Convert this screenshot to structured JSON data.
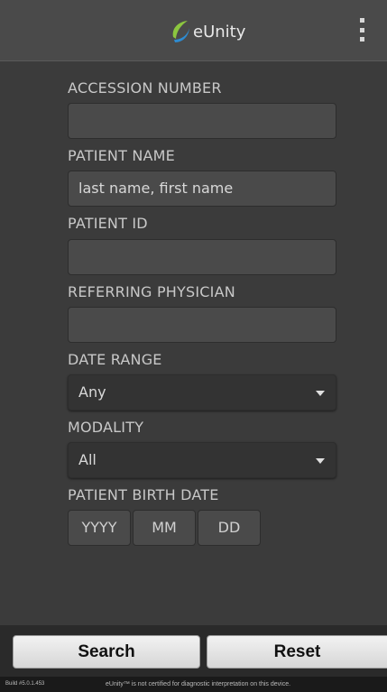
{
  "header": {
    "app_name": "eUnity",
    "logo_icon": "eunity-logo-icon",
    "menu_icon": "overflow-menu-icon"
  },
  "form": {
    "accession_number": {
      "label": "ACCESSION NUMBER",
      "value": ""
    },
    "patient_name": {
      "label": "PATIENT NAME",
      "placeholder": "last name, first name"
    },
    "patient_id": {
      "label": "PATIENT ID",
      "value": ""
    },
    "referring_physician": {
      "label": "REFERRING PHYSICIAN",
      "value": ""
    },
    "date_range": {
      "label": "DATE RANGE",
      "selected": "Any"
    },
    "modality": {
      "label": "MODALITY",
      "selected": "All"
    },
    "birth_date": {
      "label": "PATIENT BIRTH DATE",
      "year": "YYYY",
      "month": "MM",
      "day": "DD"
    }
  },
  "buttons": {
    "search": "Search",
    "reset": "Reset"
  },
  "footer": {
    "build": "Build #5.0.1.453",
    "disclaimer": "eUnity™ is not certified for diagnostic interpretation on this device."
  },
  "colors": {
    "background": "#3b3b3b",
    "header": "#4a4a4a",
    "logo_green": "#8cc63f",
    "logo_blue": "#2e8bd0"
  }
}
